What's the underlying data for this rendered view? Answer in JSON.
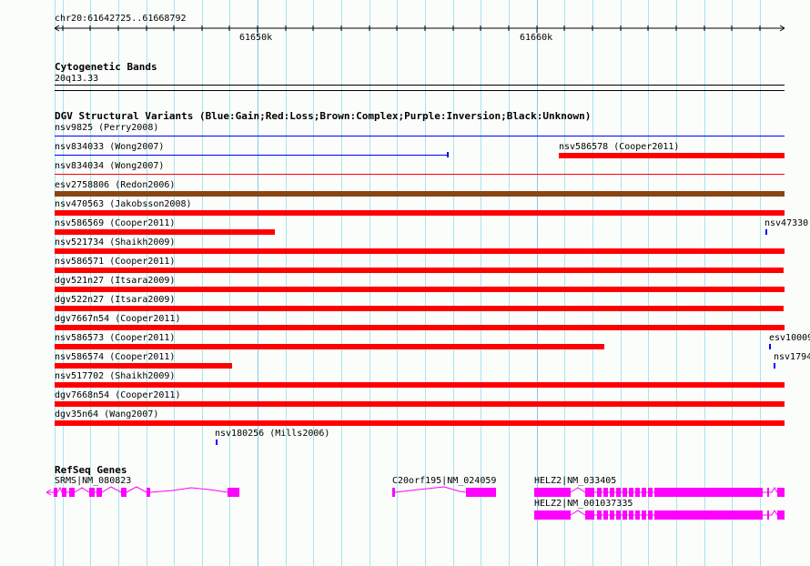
{
  "ruler": {
    "region": "chr20:61642725..61668792",
    "ticks": [
      "61650k",
      "61660k"
    ]
  },
  "cytoband": {
    "title": "Cytogenetic Bands",
    "band": "20q13.33"
  },
  "dgv": {
    "title": "DGV Structural Variants (Blue:Gain;Red:Loss;Brown:Complex;Purple:Inversion;Black:Unknown)",
    "colors": {
      "gain": "#0000ff",
      "loss": "#ff0000",
      "complex": "#8b4513",
      "gene": "#ff00ff"
    },
    "features": [
      {
        "label": "nsv9825 (Perry2008)",
        "type": "gain"
      },
      {
        "label": "nsv834033 (Wong2007)",
        "type": "gain"
      },
      {
        "label": "nsv586578 (Cooper2011)",
        "type": "loss"
      },
      {
        "label": "nsv834034 (Wong2007)",
        "type": "loss"
      },
      {
        "label": "esv2758806 (Redon2006)",
        "type": "complex"
      },
      {
        "label": "nsv470563 (Jakobsson2008)",
        "type": "loss"
      },
      {
        "label": "nsv586569 (Cooper2011)",
        "type": "loss"
      },
      {
        "label": "nsv47330",
        "type": "gain"
      },
      {
        "label": "nsv521734 (Shaikh2009)",
        "type": "loss"
      },
      {
        "label": "nsv586571 (Cooper2011)",
        "type": "loss"
      },
      {
        "label": "dgv521n27 (Itsara2009)",
        "type": "loss"
      },
      {
        "label": "dgv522n27 (Itsara2009)",
        "type": "loss"
      },
      {
        "label": "dgv7667n54 (Cooper2011)",
        "type": "loss"
      },
      {
        "label": "nsv586573 (Cooper2011)",
        "type": "loss"
      },
      {
        "label": "esv10009",
        "type": "gain"
      },
      {
        "label": "nsv586574 (Cooper2011)",
        "type": "loss"
      },
      {
        "label": "nsv1794",
        "type": "gain"
      },
      {
        "label": "nsv517702 (Shaikh2009)",
        "type": "loss"
      },
      {
        "label": "dgv7668n54 (Cooper2011)",
        "type": "loss"
      },
      {
        "label": "dgv35n64 (Wang2007)",
        "type": "loss"
      },
      {
        "label": "nsv180256 (Mills2006)",
        "type": "gain"
      }
    ]
  },
  "refseq": {
    "title": "RefSeq Genes",
    "genes": [
      {
        "label": "SRMS|NM_080823",
        "strand": "-"
      },
      {
        "label": "C20orf195|NM_024059",
        "strand": "+"
      },
      {
        "label": "HELZ2|NM_033405",
        "strand": "-"
      },
      {
        "label": "HELZ2|NM_001037335",
        "strand": "-"
      }
    ]
  }
}
